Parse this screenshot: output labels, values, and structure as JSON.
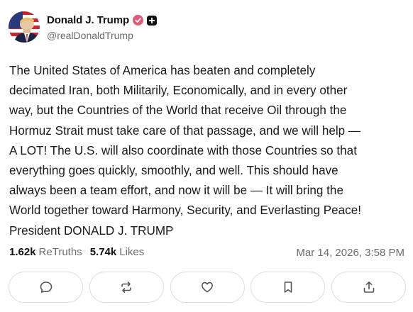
{
  "post": {
    "author": {
      "display_name": "Donald J. Trump",
      "handle": "@realDonaldTrump",
      "verified_color": "#e35b78"
    },
    "text": "The United States of America has beaten and completely\ndecimated Iran, both Militarily, Economically, and in every other\nway, but the Countries of the World that receive Oil through the\nHormuz Strait must take care of that passage, and we will help —\nA LOT! The U.S. will also coordinate with those Countries so that\neverything goes quickly, smoothly, and well. This should have\nalways been a team effort, and now it will be — It will bring the\nWorld together toward Harmony, Security, and Everlasting Peace!\nPresident DONALD J. TRUMP",
    "stats": {
      "retruths_count": "1.62k",
      "retruths_label": "ReTruths",
      "likes_count": "5.74k",
      "likes_label": "Likes"
    },
    "timestamp": "Mar 14, 2026, 3:58 PM"
  },
  "actions": [
    {
      "name": "reply",
      "icon": "comment-icon"
    },
    {
      "name": "retruth",
      "icon": "repost-icon"
    },
    {
      "name": "like",
      "icon": "heart-icon"
    },
    {
      "name": "bookmark",
      "icon": "bookmark-icon"
    },
    {
      "name": "share",
      "icon": "share-icon"
    }
  ]
}
